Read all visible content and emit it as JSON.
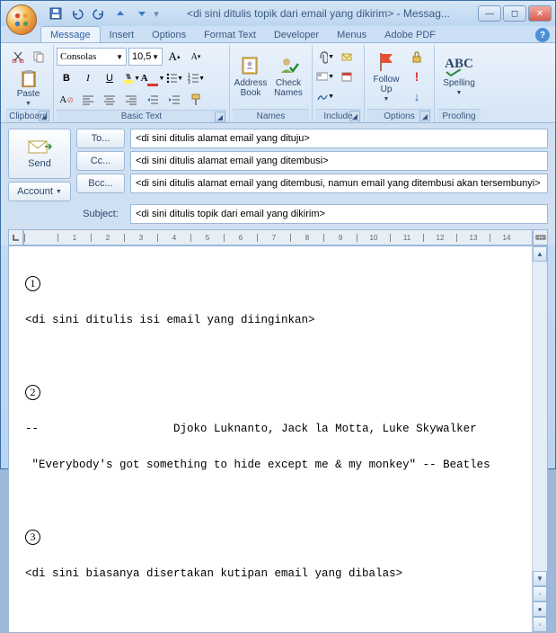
{
  "title": "<di sini ditulis topik dari email yang dikirim> - Messag...",
  "qat": {
    "save": "💾",
    "undo": "↶",
    "redo": "↷",
    "prev": "▲",
    "next": "▼"
  },
  "tabs": [
    "Message",
    "Insert",
    "Options",
    "Format Text",
    "Developer",
    "Menus",
    "Adobe PDF"
  ],
  "active_tab": "Message",
  "ribbon": {
    "clipboard": {
      "paste": "Paste",
      "label": "Clipboard"
    },
    "basic_text": {
      "font_name": "Consolas",
      "font_size": "10,5",
      "label": "Basic Text"
    },
    "names": {
      "address_book": "Address\nBook",
      "check_names": "Check\nNames",
      "label": "Names"
    },
    "include": {
      "label": "Include"
    },
    "options": {
      "followup": "Follow\nUp",
      "label": "Options"
    },
    "proofing": {
      "spelling": "Spelling",
      "label": "Proofing"
    }
  },
  "header": {
    "send": "Send",
    "account": "Account",
    "to_btn": "To...",
    "cc_btn": "Cc...",
    "bcc_btn": "Bcc...",
    "subject_label": "Subject:",
    "to": "<di sini ditulis alamat email yang dituju>",
    "cc": "<di sini ditulis alamat email yang ditembusi>",
    "bcc": "<di sini ditulis alamat email yang ditembusi, namun email yang ditembusi akan tersembunyi>",
    "subject": "<di sini ditulis topik dari email yang dikirim>"
  },
  "body": {
    "l1": "<di sini ditulis isi email yang diinginkan>",
    "sig_sep": "--",
    "sig_name": "Djoko Luknanto, Jack la Motta, Luke Skywalker",
    "sig_quote": "\"Everybody's got something to hide except me & my monkey\" -- Beatles",
    "l3": "<di sini biasanya disertakan kutipan email yang dibalas>"
  }
}
